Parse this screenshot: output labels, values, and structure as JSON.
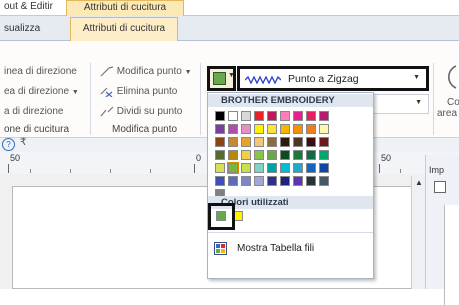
{
  "top_tabs": {
    "layout": "out & Editir",
    "attributes": "Attributi di cucitura"
  },
  "sub_tabs": {
    "visualize": "sualizza",
    "attributes": "Attributi di cucitura"
  },
  "ribbon": {
    "left_items": [
      "inea di direzione",
      "ea di direzione",
      "a di direzione"
    ],
    "left_group": "one di cucitura",
    "mid_items": [
      "Modifica punto",
      "Elimina punto",
      "Dividi su punto"
    ],
    "mid_group": "Modifica punto",
    "right_text": [
      "Co",
      "area"
    ]
  },
  "stitch_selector": {
    "value": "Punto a Zigzag"
  },
  "ruler": {
    "labels": [
      "50",
      "0",
      "50"
    ]
  },
  "right_panel": {
    "label": "Imp"
  },
  "dropdown": {
    "section_title": "BROTHER EMBROIDERY",
    "recent_title": "Colori utilizzati",
    "show_table_label": "Mostra Tabella fili",
    "palette_rows": [
      [
        "#000000",
        "#ffffff",
        "#d8d8d8",
        "#e8232a",
        "#c2185b",
        "#ff7eb9",
        "#e62090",
        "#e91e63",
        "#b71c72"
      ],
      [
        "#7b3fa0",
        "#b04fb0",
        "#e78fc2",
        "#fff200",
        "#f7e33b",
        "#f7b500",
        "#f39200",
        "#ee7d21",
        "#fff8b0"
      ],
      [
        "#8b4513",
        "#c58a2e",
        "#e8a42a",
        "#f2c77a",
        "#8a6d3b",
        "#2d1b0e",
        "#4a3728",
        "#3b0f0f",
        "#6b1a1a"
      ],
      [
        "#556b2f",
        "#b8860b",
        "#f2ce4d",
        "#8bc34a",
        "#6aa84f",
        "#0b4d1e",
        "#1b7a3a",
        "#0e6b45",
        "#00a86b"
      ],
      [
        "#d4e157",
        "#7cb342",
        "#c6e24a",
        "#81d4c4",
        "#00a3a3",
        "#00bcd4",
        "#26a6c9",
        "#1565c0",
        "#0d47a1"
      ],
      [
        "#3f51b5",
        "#5c6bc0",
        "#7986cb",
        "#9fa8da",
        "#2e3192",
        "#1a237e",
        "#5e35b1",
        "#263238",
        "#455a64"
      ],
      [
        "#808080"
      ]
    ],
    "selected": {
      "row": 4,
      "col": 1
    },
    "recent_colors": [
      "#6aa84f",
      "#fff200"
    ]
  },
  "colors": {
    "accent_tab": "#fde9b6",
    "stitch_line": "#2b3bd6"
  }
}
